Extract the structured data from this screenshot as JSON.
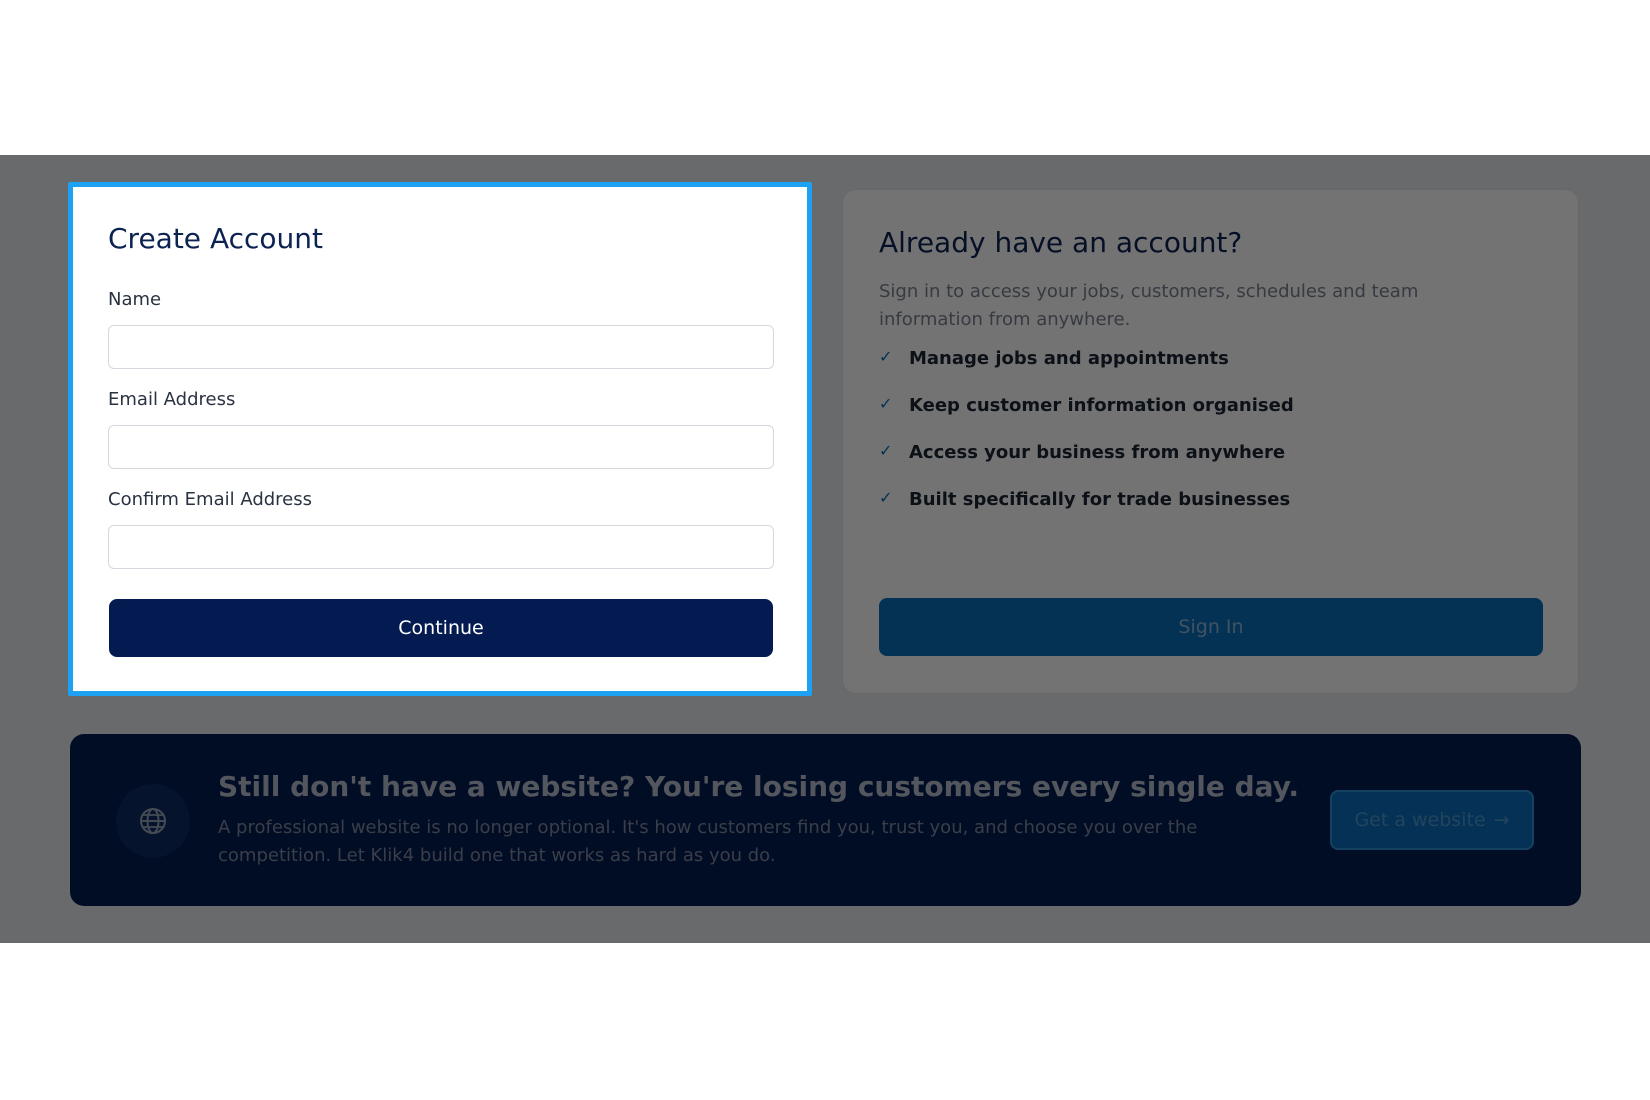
{
  "create_account": {
    "title": "Create Account",
    "name_label": "Name",
    "name_value": "",
    "email_label": "Email Address",
    "email_value": "",
    "confirm_label": "Confirm Email Address",
    "confirm_value": "",
    "continue_label": "Continue"
  },
  "signin": {
    "title": "Already have an account?",
    "subtitle": "Sign in to access your jobs, customers, schedules and team information from anywhere.",
    "benefits": [
      "Manage jobs and appointments",
      "Keep customer information organised",
      "Access your business from anywhere",
      "Built specifically for trade businesses"
    ],
    "check_glyph": "✓",
    "button_label": "Sign In"
  },
  "promo": {
    "icon": "globe-icon",
    "title": "Still don't have a website? You're losing customers every single day.",
    "body": "A professional website is no longer optional. It's how customers find you, trust you, and choose you over the competition. Let Klik4 build one that works as hard as you do.",
    "button_label": "Get a website",
    "button_arrow": "→"
  },
  "colors": {
    "navy": "#041b52",
    "accent_blue": "#0a70bd",
    "focus_outline": "#1da1f2"
  }
}
